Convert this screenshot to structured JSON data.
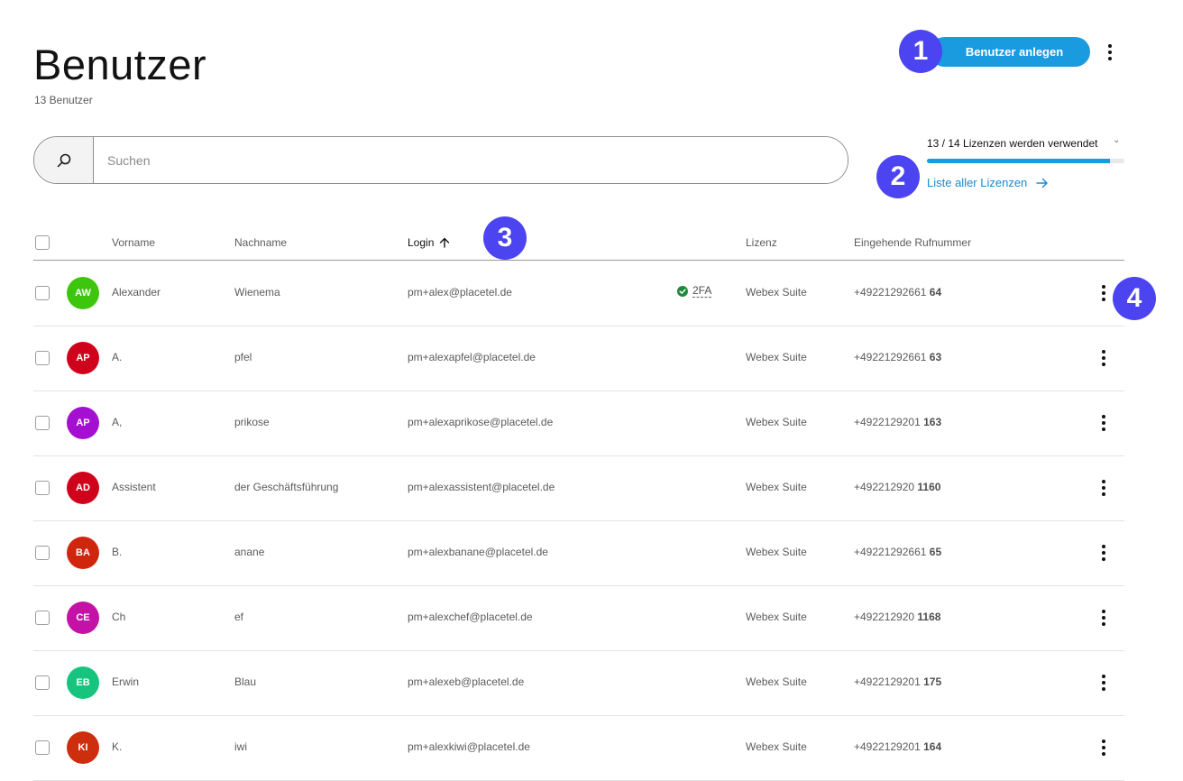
{
  "header": {
    "title": "Benutzer",
    "user_count": "13 Benutzer",
    "create_button": "Benutzer anlegen"
  },
  "search": {
    "placeholder": "Suchen"
  },
  "licenses": {
    "summary": "13 / 14 Lizenzen werden verwendet",
    "used": 13,
    "total": 14,
    "link_label": "Liste aller Lizenzen"
  },
  "annotations": [
    "1",
    "2",
    "3",
    "4"
  ],
  "table": {
    "columns": {
      "first": "Vorname",
      "last": "Nachname",
      "login": "Login",
      "license": "Lizenz",
      "phone": "Eingehende Rufnummer"
    },
    "sort": {
      "column": "login",
      "direction": "ascending"
    },
    "rows": [
      {
        "initials": "AW",
        "color": "#3ec60f",
        "first": "Alexander",
        "last": "Wienema",
        "login": "pm+alex@placetel.de",
        "twofa": "2FA",
        "license": "Webex Suite",
        "phone_prefix": "+49221292661",
        "phone_ext": "64"
      },
      {
        "initials": "AP",
        "color": "#d0021b",
        "first": "A.",
        "last": "pfel",
        "login": "pm+alexapfel@placetel.de",
        "twofa": "",
        "license": "Webex Suite",
        "phone_prefix": "+49221292661",
        "phone_ext": "63"
      },
      {
        "initials": "AP",
        "color": "#a50fd1",
        "first": "A,",
        "last": "prikose",
        "login": "pm+alexaprikose@placetel.de",
        "twofa": "",
        "license": "Webex Suite",
        "phone_prefix": "+4922129201",
        "phone_ext": "163"
      },
      {
        "initials": "AD",
        "color": "#d0021b",
        "first": "Assistent",
        "last": "der Geschäftsführung",
        "login": "pm+alexassistent@placetel.de",
        "twofa": "",
        "license": "Webex Suite",
        "phone_prefix": "+492212920",
        "phone_ext": "1160"
      },
      {
        "initials": "BA",
        "color": "#d0260e",
        "first": "B.",
        "last": "anane",
        "login": "pm+alexbanane@placetel.de",
        "twofa": "",
        "license": "Webex Suite",
        "phone_prefix": "+49221292661",
        "phone_ext": "65"
      },
      {
        "initials": "CE",
        "color": "#c412a6",
        "first": "Ch",
        "last": "ef",
        "login": "pm+alexchef@placetel.de",
        "twofa": "",
        "license": "Webex Suite",
        "phone_prefix": "+492212920",
        "phone_ext": "1168"
      },
      {
        "initials": "EB",
        "color": "#17c47e",
        "first": "Erwin",
        "last": "Blau",
        "login": "pm+alexeb@placetel.de",
        "twofa": "",
        "license": "Webex Suite",
        "phone_prefix": "+4922129201",
        "phone_ext": "175"
      },
      {
        "initials": "KI",
        "color": "#cc2e0e",
        "first": "K.",
        "last": "iwi",
        "login": "pm+alexkiwi@placetel.de",
        "twofa": "",
        "license": "Webex Suite",
        "phone_prefix": "+4922129201",
        "phone_ext": "164"
      }
    ]
  }
}
